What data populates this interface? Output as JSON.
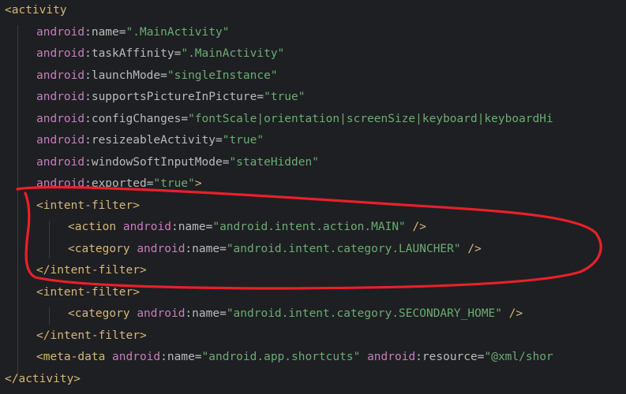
{
  "editor": {
    "lines": [
      {
        "indent": 0,
        "tokens": [
          {
            "t": "tag",
            "v": "<activity"
          }
        ]
      },
      {
        "indent": 1,
        "tokens": [
          {
            "t": "ns",
            "v": "android"
          },
          {
            "t": "punc",
            "v": ":"
          },
          {
            "t": "attr",
            "v": "name"
          },
          {
            "t": "punc",
            "v": "="
          },
          {
            "t": "str",
            "v": "\".MainActivity\""
          }
        ]
      },
      {
        "indent": 1,
        "tokens": [
          {
            "t": "ns",
            "v": "android"
          },
          {
            "t": "punc",
            "v": ":"
          },
          {
            "t": "attr",
            "v": "taskAffinity"
          },
          {
            "t": "punc",
            "v": "="
          },
          {
            "t": "str",
            "v": "\".MainActivity\""
          }
        ]
      },
      {
        "indent": 1,
        "tokens": [
          {
            "t": "ns",
            "v": "android"
          },
          {
            "t": "punc",
            "v": ":"
          },
          {
            "t": "attr",
            "v": "launchMode"
          },
          {
            "t": "punc",
            "v": "="
          },
          {
            "t": "str",
            "v": "\"singleInstance\""
          }
        ]
      },
      {
        "indent": 1,
        "tokens": [
          {
            "t": "ns",
            "v": "android"
          },
          {
            "t": "punc",
            "v": ":"
          },
          {
            "t": "attr",
            "v": "supportsPictureInPicture"
          },
          {
            "t": "punc",
            "v": "="
          },
          {
            "t": "str",
            "v": "\"true\""
          }
        ]
      },
      {
        "indent": 1,
        "tokens": [
          {
            "t": "ns",
            "v": "android"
          },
          {
            "t": "punc",
            "v": ":"
          },
          {
            "t": "attr",
            "v": "configChanges"
          },
          {
            "t": "punc",
            "v": "="
          },
          {
            "t": "str",
            "v": "\"fontScale|orientation|screenSize|keyboard|keyboardHi"
          }
        ]
      },
      {
        "indent": 1,
        "tokens": [
          {
            "t": "ns",
            "v": "android"
          },
          {
            "t": "punc",
            "v": ":"
          },
          {
            "t": "attr",
            "v": "resizeableActivity"
          },
          {
            "t": "punc",
            "v": "="
          },
          {
            "t": "str",
            "v": "\"true\""
          }
        ]
      },
      {
        "indent": 1,
        "tokens": [
          {
            "t": "ns",
            "v": "android"
          },
          {
            "t": "punc",
            "v": ":"
          },
          {
            "t": "attr",
            "v": "windowSoftInputMode"
          },
          {
            "t": "punc",
            "v": "="
          },
          {
            "t": "str",
            "v": "\"stateHidden\""
          }
        ]
      },
      {
        "indent": 1,
        "tokens": [
          {
            "t": "ns",
            "v": "android"
          },
          {
            "t": "punc",
            "v": ":"
          },
          {
            "t": "attr",
            "v": "exported"
          },
          {
            "t": "punc",
            "v": "="
          },
          {
            "t": "str",
            "v": "\"true\""
          },
          {
            "t": "tag",
            "v": ">"
          }
        ]
      },
      {
        "indent": 1,
        "tokens": [
          {
            "t": "tag",
            "v": "<intent-filter>"
          }
        ]
      },
      {
        "indent": 2,
        "tokens": [
          {
            "t": "tag",
            "v": "<action "
          },
          {
            "t": "ns",
            "v": "android"
          },
          {
            "t": "punc",
            "v": ":"
          },
          {
            "t": "attr",
            "v": "name"
          },
          {
            "t": "punc",
            "v": "="
          },
          {
            "t": "str",
            "v": "\"android.intent.action.MAIN\""
          },
          {
            "t": "tag",
            "v": " />"
          }
        ]
      },
      {
        "indent": 2,
        "tokens": [
          {
            "t": "tag",
            "v": "<category "
          },
          {
            "t": "ns",
            "v": "android"
          },
          {
            "t": "punc",
            "v": ":"
          },
          {
            "t": "attr",
            "v": "name"
          },
          {
            "t": "punc",
            "v": "="
          },
          {
            "t": "str",
            "v": "\"android.intent.category.LAUNCHER\""
          },
          {
            "t": "tag",
            "v": " />"
          }
        ]
      },
      {
        "indent": 1,
        "tokens": [
          {
            "t": "tag",
            "v": "</intent-filter>"
          }
        ]
      },
      {
        "indent": 1,
        "tokens": [
          {
            "t": "tag",
            "v": "<intent-filter>"
          }
        ]
      },
      {
        "indent": 2,
        "tokens": [
          {
            "t": "tag",
            "v": "<category "
          },
          {
            "t": "ns",
            "v": "android"
          },
          {
            "t": "punc",
            "v": ":"
          },
          {
            "t": "attr",
            "v": "name"
          },
          {
            "t": "punc",
            "v": "="
          },
          {
            "t": "str",
            "v": "\"android.intent.category.SECONDARY_HOME\""
          },
          {
            "t": "tag",
            "v": " />"
          }
        ]
      },
      {
        "indent": 1,
        "tokens": [
          {
            "t": "tag",
            "v": "</intent-filter>"
          }
        ]
      },
      {
        "indent": 1,
        "tokens": [
          {
            "t": "tag",
            "v": "<meta-data "
          },
          {
            "t": "ns",
            "v": "android"
          },
          {
            "t": "punc",
            "v": ":"
          },
          {
            "t": "attr",
            "v": "name"
          },
          {
            "t": "punc",
            "v": "="
          },
          {
            "t": "str",
            "v": "\"android.app.shortcuts\""
          },
          {
            "t": "punc",
            "v": " "
          },
          {
            "t": "ns",
            "v": "android"
          },
          {
            "t": "punc",
            "v": ":"
          },
          {
            "t": "attr",
            "v": "resource"
          },
          {
            "t": "punc",
            "v": "="
          },
          {
            "t": "str",
            "v": "\"@xml/shor"
          }
        ]
      },
      {
        "indent": 0,
        "tokens": [
          {
            "t": "tag",
            "v": "</activity>"
          }
        ]
      }
    ]
  },
  "colors": {
    "background": "#1e1f22",
    "tag": "#d5b778",
    "namespace": "#c77dbb",
    "attribute": "#bababa",
    "string": "#6aab73",
    "annotation": "#e8202a"
  }
}
